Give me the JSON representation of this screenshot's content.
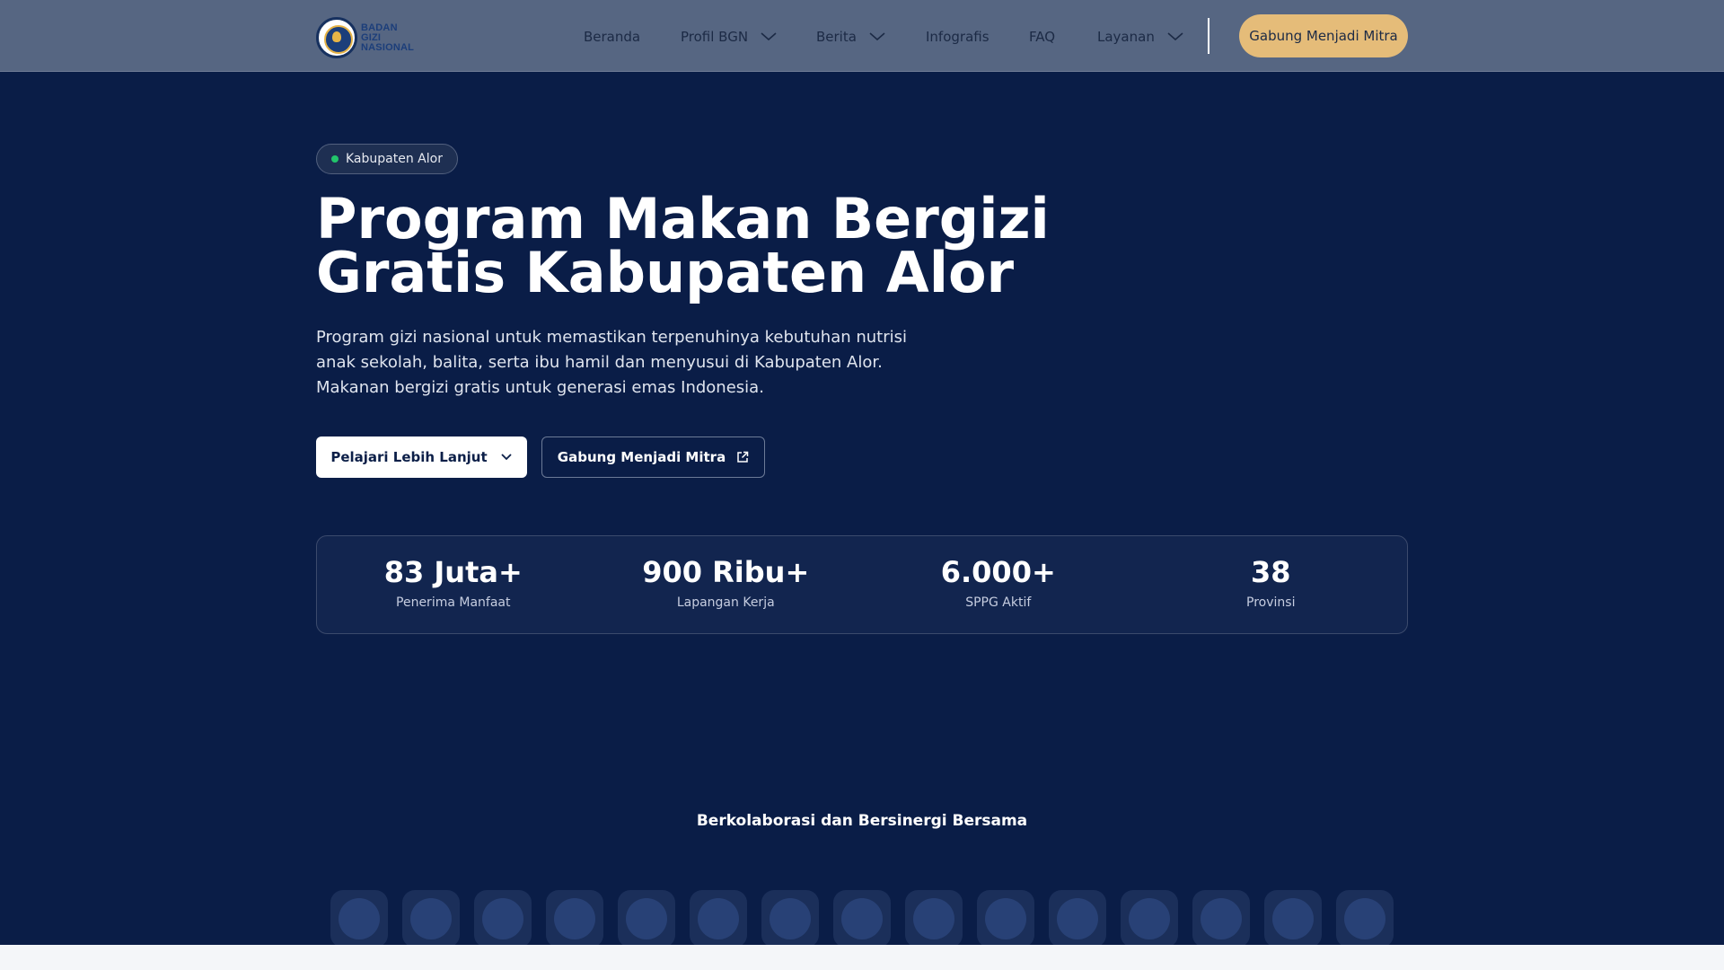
{
  "nav": {
    "logo_lines": [
      "BADAN",
      "GIZI",
      "NASIONAL"
    ],
    "items": [
      {
        "label": "Beranda",
        "dropdown": false
      },
      {
        "label": "Profil BGN",
        "dropdown": true
      },
      {
        "label": "Berita",
        "dropdown": true
      },
      {
        "label": "Infografis",
        "dropdown": false
      },
      {
        "label": "FAQ",
        "dropdown": false
      },
      {
        "label": "Layanan",
        "dropdown": true
      }
    ],
    "cta_label": "Gabung Menjadi Mitra"
  },
  "hero": {
    "badge": "Kabupaten Alor",
    "title_line1": "Program Makan Bergizi",
    "title_line2": "Gratis Kabupaten Alor",
    "description_lines": [
      "Program gizi nasional untuk memastikan terpenuhinya kebutuhan nutrisi",
      "anak sekolah, balita, serta ibu hamil dan menyusui di Kabupaten Alor.",
      "Makanan bergizi gratis untuk generasi emas Indonesia."
    ],
    "primary_button": "Pelajari Lebih Lanjut",
    "secondary_button": "Gabung Menjadi Mitra"
  },
  "stats": [
    {
      "value": "83 Juta+",
      "label": "Penerima Manfaat"
    },
    {
      "value": "900 Ribu+",
      "label": "Lapangan Kerja"
    },
    {
      "value": "6.000+",
      "label": "SPPG Aktif"
    },
    {
      "value": "38",
      "label": "Provinsi"
    }
  ],
  "partners": {
    "title": "Berkolaborasi dan Bersinergi Bersama",
    "logos": [
      "partner-logo",
      "partner-logo",
      "partner-logo",
      "partner-logo",
      "partner-logo",
      "partner-logo",
      "partner-logo",
      "partner-logo",
      "partner-logo",
      "partner-logo",
      "partner-logo",
      "partner-logo",
      "partner-logo",
      "partner-logo",
      "partner-logo"
    ]
  },
  "colors": {
    "page_bg": "#0a1d47",
    "nav_bg": "#566682",
    "cta_bg": "#e5bc79",
    "badge_dot": "#22c56b"
  }
}
